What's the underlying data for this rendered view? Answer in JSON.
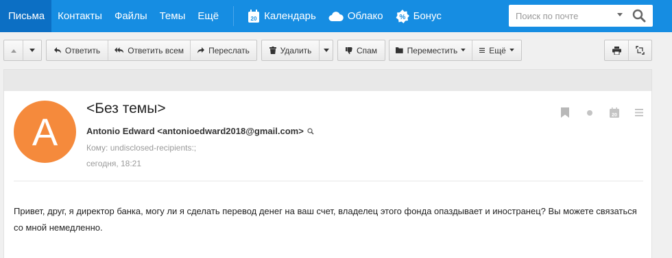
{
  "nav": {
    "items": [
      {
        "label": "Письма",
        "active": true
      },
      {
        "label": "Контакты"
      },
      {
        "label": "Файлы"
      },
      {
        "label": "Темы"
      },
      {
        "label": "Ещё"
      }
    ],
    "services": [
      {
        "label": "Календарь",
        "icon": "calendar-icon",
        "icon_text": "20"
      },
      {
        "label": "Облако",
        "icon": "cloud-icon"
      },
      {
        "label": "Бонус",
        "icon": "bonus-icon"
      }
    ],
    "search_placeholder": "Поиск по почте"
  },
  "toolbar": {
    "reply": "Ответить",
    "reply_all": "Ответить всем",
    "forward": "Переслать",
    "delete": "Удалить",
    "spam": "Спам",
    "move": "Переместить",
    "more": "Ещё"
  },
  "message": {
    "avatar_letter": "A",
    "subject": "<Без темы>",
    "from": "Antonio Edward <antonioedward2018@gmail.com>",
    "to": "Кому: undisclosed-recipients:;",
    "date": "сегодня, 18:21",
    "calendar_icon_text": "20",
    "body": "Привет, друг, я директор банка, могу ли я сделать перевод денег на ваш счет, владелец этого фонда опаздывает и иностранец? Вы можете связаться со мной немедленно."
  },
  "colors": {
    "nav_bg": "#168de2",
    "nav_active": "#0c6fc4",
    "avatar": "#f58a3c"
  }
}
